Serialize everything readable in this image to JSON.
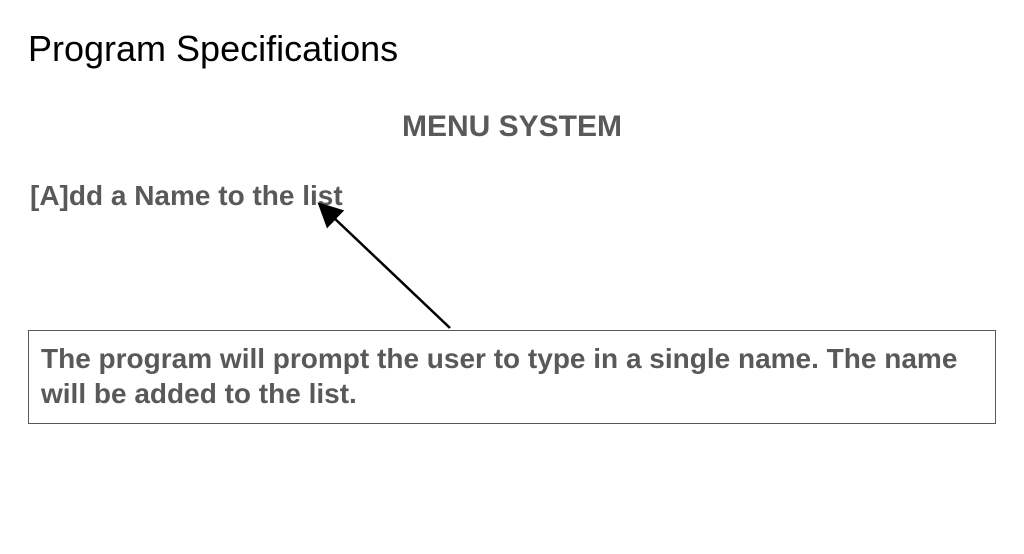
{
  "title": "Program Specifications",
  "menu_heading": "MENU SYSTEM",
  "menu_option": "[A]dd a Name to the list",
  "description": "The program will prompt the user to type in a single name.  The name will be added to the list."
}
